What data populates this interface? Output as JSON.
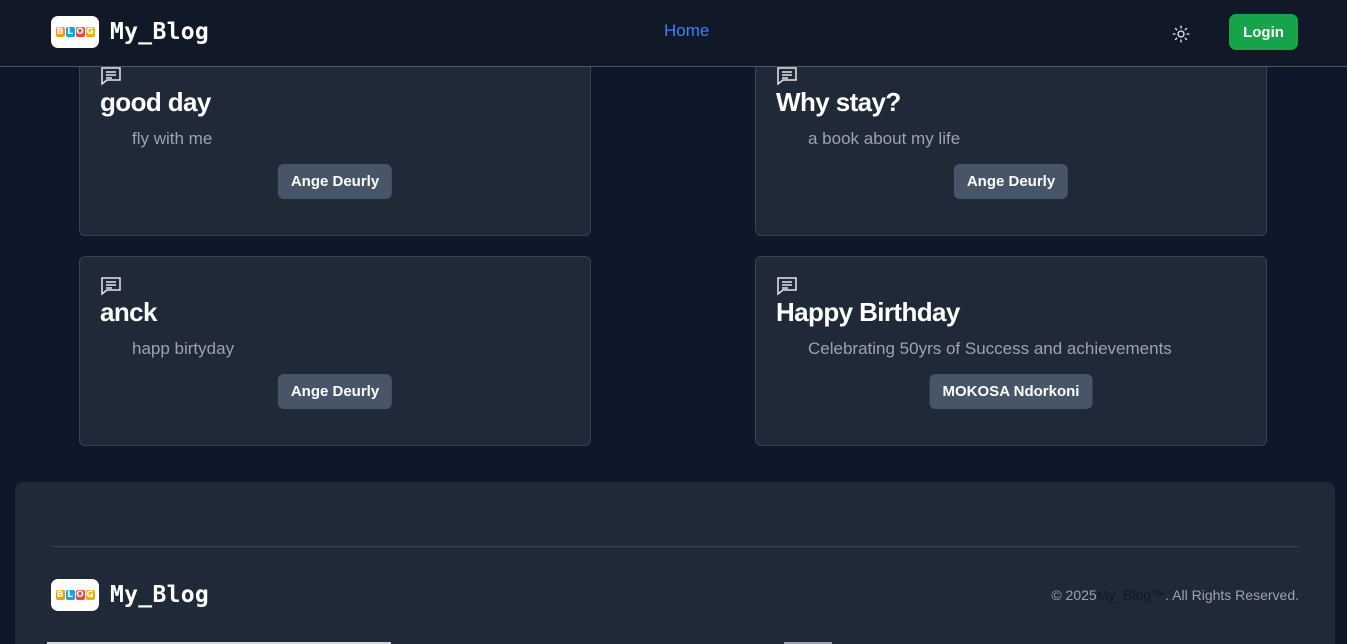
{
  "brand": {
    "name": "My_Blog",
    "logo_letters": [
      "B",
      "L",
      "O",
      "G"
    ],
    "logo_colors": [
      "#f59e0b",
      "#0ea5e9",
      "#ef4444",
      "#eab308"
    ]
  },
  "nav": {
    "home_label": "Home",
    "theme_toggle_icon": "sun-icon",
    "login_label": "Login"
  },
  "colors": {
    "background": "#0f172a",
    "navbar": "#111827",
    "card": "#1f2937",
    "accent_link": "#3b82f6",
    "login_green": "#16a34a",
    "author_badge": "#475569"
  },
  "posts": [
    {
      "title": "good day",
      "description": "fly with me",
      "author": "Ange Deurly",
      "icon": "chat-icon"
    },
    {
      "title": "Why stay?",
      "description": "a book about my life",
      "author": "Ange Deurly",
      "icon": "chat-icon"
    },
    {
      "title": "anck",
      "description": "happ birtyday",
      "author": "Ange Deurly",
      "icon": "chat-icon"
    },
    {
      "title": "Happy Birthday",
      "description": "Celebrating 50yrs of Success and achievements",
      "author": "MOKOSA Ndorkoni",
      "icon": "chat-icon"
    }
  ],
  "footer": {
    "brand_name": "My_Blog",
    "copyright_prefix": "© 2025",
    "copyright_brand": "My_Blog™",
    "copyright_suffix": ". All Rights Reserved."
  }
}
